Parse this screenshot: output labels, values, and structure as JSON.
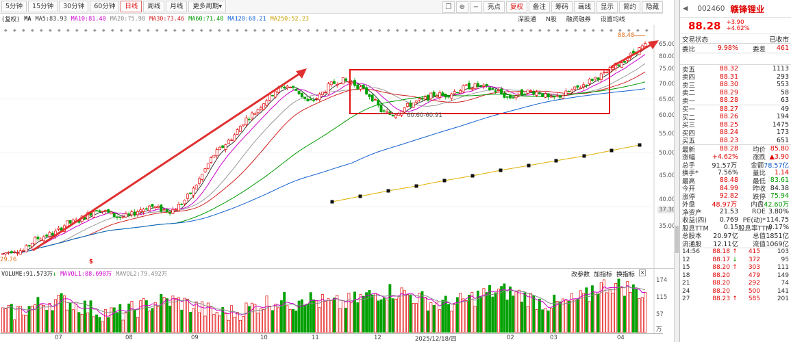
{
  "toolbar": {
    "tabs": [
      "5分钟",
      "15分钟",
      "30分钟",
      "60分钟",
      "日线",
      "周线",
      "月线",
      "更多周期"
    ],
    "active_tab": "日线",
    "more_arrow": "▾",
    "right_buttons": {
      "highlight": "亮点",
      "restore": "复权",
      "notes": "备注",
      "marks": "筹码",
      "chart_lines": "画线",
      "display": "显示",
      "simple": "简约",
      "hide": "隐藏"
    },
    "icons": {
      "copy": "❐",
      "minus": "−",
      "expand": "⊕"
    }
  },
  "ma_legend": {
    "prefix": "(复权)",
    "items": [
      {
        "label": "MA",
        "value": "",
        "color": "#333333"
      },
      {
        "label": "MA5:",
        "value": "83.93",
        "color": "#333333"
      },
      {
        "label": "MA10:",
        "value": "81.40",
        "color": "#cc00cc"
      },
      {
        "label": "MA20:",
        "value": "75.98",
        "color": "#888888"
      },
      {
        "label": "MA30:",
        "value": "73.46",
        "color": "#d02020"
      },
      {
        "label": "MA60:",
        "value": "71.40",
        "color": "#009900"
      },
      {
        "label": "MA120:",
        "value": "68.21",
        "color": "#1060d0"
      },
      {
        "label": "MA250:",
        "value": "52.23",
        "color": "#c8a000"
      }
    ]
  },
  "sub_toolbar": [
    "深股通",
    "N股",
    "融资融券",
    "设置均线"
  ],
  "y_axis": {
    "labels": [
      "65.00",
      "60.00",
      "55.00",
      "50.00",
      "45.00",
      "40.00",
      "37.30",
      "35.00"
    ],
    "extra_labels": [
      "70.00",
      "65.00",
      "60.00",
      "55.00"
    ]
  },
  "price_annotations": {
    "high": "88.48",
    "low": "29.76",
    "range_label": "60.60-60.91",
    "dollar_marker": "$"
  },
  "chart_data": {
    "type": "line",
    "title": "",
    "x_months": [
      "07",
      "08",
      "09",
      "10",
      "11",
      "12",
      "2025/12/18/四",
      "02",
      "03",
      "04"
    ],
    "y_axis_ticks": [
      35,
      40,
      45,
      50,
      55,
      60,
      65,
      70,
      75,
      80,
      85
    ],
    "close_series": [
      30.5,
      31.2,
      31.0,
      32.8,
      33.5,
      34.0,
      35.6,
      36.0,
      37.2,
      38.5,
      37.6,
      36.8,
      37.0,
      38.2,
      39.0,
      38.3,
      38.0,
      39.5,
      42.0,
      46.0,
      50.5,
      53.0,
      56.0,
      60.5,
      63.0,
      67.0,
      70.5,
      72.0,
      70.0,
      66.0,
      68.0,
      72.0,
      74.0,
      73.5,
      71.0,
      68.0,
      63.0,
      62.0,
      64.0,
      66.0,
      67.0,
      69.0,
      68.5,
      70.0,
      71.5,
      72.0,
      71.0,
      70.0,
      67.5,
      69.0,
      70.0,
      69.5,
      67.0,
      68.5,
      70.0,
      72.0,
      74.5,
      76.0,
      79.0,
      82.0,
      85.5,
      88.28
    ],
    "volume_axis": [
      0,
      57,
      115,
      174
    ],
    "volume_label": "万"
  },
  "volume_legend": {
    "vol": "VOLUME:91.573万",
    "vol_arrow": "↓",
    "mavol1": "MAVOL1:88.690万",
    "mavol2": "MAVOL2:79.492万",
    "tools": [
      "改参数",
      "加指标",
      "换指标"
    ],
    "close_icon": "×"
  },
  "right_panel": {
    "code": "002460",
    "name": "赣锋锂业",
    "price": "88.28",
    "change": "+3.90",
    "change_pct": "+4.62%",
    "trade_status_label": "交易状态",
    "trade_status": "已收市",
    "weibi_label": "委比",
    "weibi": "9.98%",
    "weicha_label": "委差",
    "weicha": "461",
    "sells": [
      {
        "label": "卖五",
        "price": "88.32",
        "vol": "1113"
      },
      {
        "label": "卖四",
        "price": "88.31",
        "vol": "293"
      },
      {
        "label": "卖三",
        "price": "88.30",
        "vol": "553"
      },
      {
        "label": "卖二",
        "price": "88.29",
        "vol": "58"
      },
      {
        "label": "卖一",
        "price": "88.28",
        "vol": "63"
      }
    ],
    "buys": [
      {
        "label": "买一",
        "price": "88.27",
        "vol": "49"
      },
      {
        "label": "买二",
        "price": "88.26",
        "vol": "194"
      },
      {
        "label": "买三",
        "price": "88.25",
        "vol": "1475"
      },
      {
        "label": "买四",
        "price": "88.24",
        "vol": "173"
      },
      {
        "label": "买五",
        "price": "88.23",
        "vol": "651"
      }
    ],
    "stats": [
      {
        "l1": "最新",
        "v1": "88.28",
        "c1": "red",
        "l2": "均价",
        "v2": "85.80",
        "c2": "red"
      },
      {
        "l1": "涨幅",
        "v1": "+4.62%",
        "c1": "red",
        "l2": "涨跌",
        "v2": "▲3.90",
        "c2": "red"
      },
      {
        "l1": "总手",
        "v1": "91.57万",
        "c1": "dk",
        "l2": "金额",
        "v2": "78.57亿",
        "c2": "blue"
      },
      {
        "l1": "换手*",
        "v1": "7.56%",
        "c1": "dk",
        "l2": "量比",
        "v2": "1.14",
        "c2": "red"
      },
      {
        "l1": "最高",
        "v1": "88.48",
        "c1": "red",
        "l2": "最低",
        "v2": "83.61",
        "c2": "green"
      },
      {
        "l1": "今开",
        "v1": "84.99",
        "c1": "red",
        "l2": "昨收",
        "v2": "84.38",
        "c2": "dk"
      },
      {
        "l1": "涨停",
        "v1": "92.82",
        "c1": "red",
        "l2": "跌停",
        "v2": "75.94",
        "c2": "green"
      },
      {
        "l1": "外盘",
        "v1": "48.97万",
        "c1": "red",
        "l2": "内盘",
        "v2": "42.60万",
        "c2": "green"
      },
      {
        "l1": "净资产",
        "v1": "21.53",
        "c1": "dk",
        "l2": "ROE",
        "v2": "3.80%",
        "c2": "dk"
      },
      {
        "l1": "收益(四)",
        "v1": "0.769",
        "c1": "dk",
        "l2": "PE(动)*",
        "v2": "114.75",
        "c2": "dk"
      },
      {
        "l1": "股息TTM",
        "v1": "0.15",
        "c1": "dk",
        "l2": "股息率TTM",
        "v2": "0.17%",
        "c2": "dk"
      },
      {
        "l1": "总股本",
        "v1": "20.97亿",
        "c1": "dk",
        "l2": "总值",
        "v2": "1851亿",
        "c2": "dk"
      },
      {
        "l1": "流通股",
        "v1": "12.11亿",
        "c1": "dk",
        "l2": "流值",
        "v2": "1069亿",
        "c2": "dk"
      }
    ],
    "ticks": [
      {
        "t": "14:56",
        "p": "88.18",
        "a": "↑",
        "v": "415",
        "n": "103"
      },
      {
        "t": "12",
        "p": "88.17",
        "a": "↓",
        "v": "372",
        "n": "95"
      },
      {
        "t": "15",
        "p": "88.20",
        "a": "↑",
        "v": "303",
        "n": "111"
      },
      {
        "t": "18",
        "p": "88.20",
        "a": "",
        "v": "479",
        "n": "149"
      },
      {
        "t": "21",
        "p": "88.20",
        "a": "",
        "v": "292",
        "n": "74"
      },
      {
        "t": "24",
        "p": "88.20",
        "a": "",
        "v": "500",
        "n": "141"
      },
      {
        "t": "27",
        "p": "88.23",
        "a": "↑",
        "v": "585",
        "n": "201"
      }
    ]
  }
}
